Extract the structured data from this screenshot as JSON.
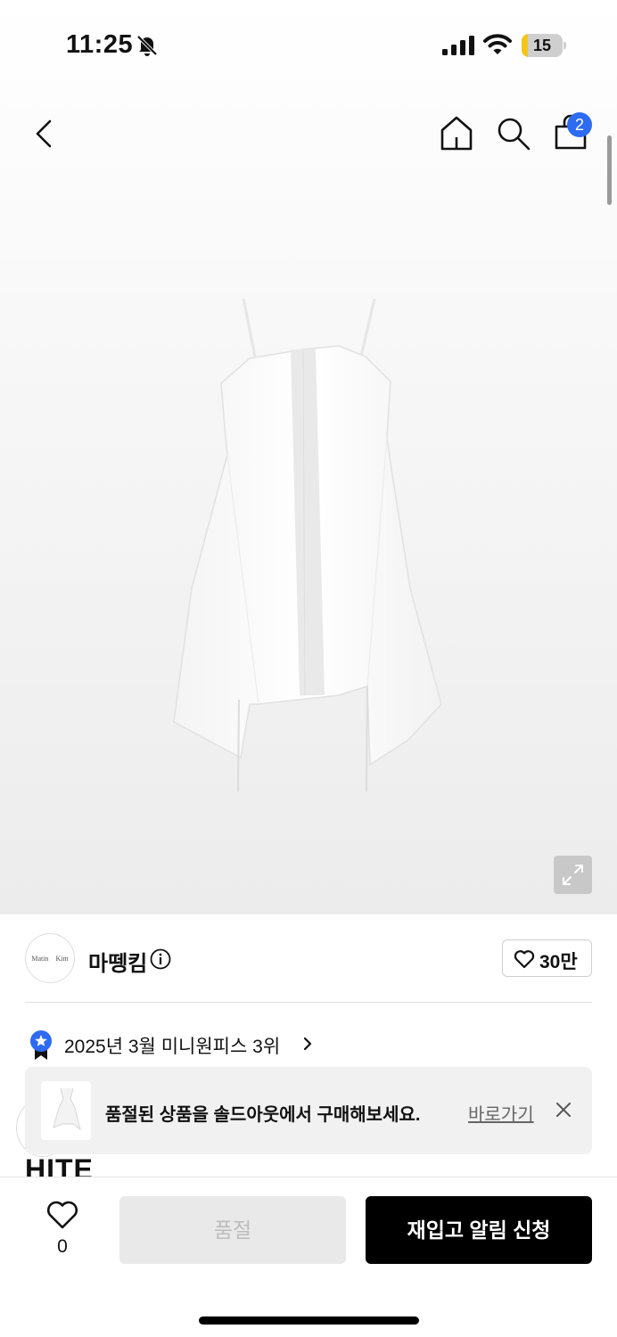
{
  "status_bar": {
    "time": "11:25",
    "battery_level": "15",
    "battery_fraction": 0.15,
    "icons": [
      "bell-off-icon",
      "signal-icon",
      "wifi-icon",
      "battery-icon"
    ]
  },
  "top_nav": {
    "icons": [
      "back-arrow-icon",
      "home-icon",
      "search-icon",
      "shopping-bag-icon"
    ],
    "cart_count": "2"
  },
  "product_image": {
    "icons": [
      "expand-icon"
    ]
  },
  "brand": {
    "logo_text": "Matin Kim",
    "name": "마뗑킴",
    "follow_count": "30만"
  },
  "ranking": {
    "text": "2025년 3월 미니원피스 3위"
  },
  "banner": {
    "text": "품절된 상품을 솔드아웃에서 구매해보세요.",
    "link": "바로가기"
  },
  "peek": {
    "text": "HITE"
  },
  "bottom_bar": {
    "like_count": "0",
    "soldout_label": "품절",
    "restock_label": "재입고 알림 신청"
  },
  "colors": {
    "accent_blue": "#2d6bf0",
    "primary_button": "#000000",
    "battery_yellow": "#f5c518"
  }
}
